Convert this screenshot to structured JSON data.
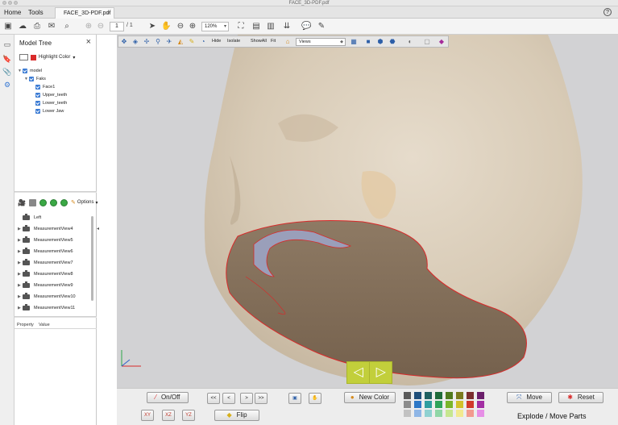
{
  "window": {
    "title": "FACE_3D-PDF.pdf"
  },
  "tabs": {
    "home": "Home",
    "tools": "Tools",
    "doc": "FACE_3D-PDF.pdf",
    "close": "×",
    "help": "?"
  },
  "toolbar": {
    "page_current": "1",
    "page_total": "/ 1",
    "zoom": "120%",
    "icons": [
      "save-icon",
      "upload-icon",
      "print-icon",
      "email-icon",
      "search-icon",
      "prev-page-icon",
      "next-page-icon",
      "select-cursor-icon",
      "hand-icon",
      "zoom-out-icon",
      "zoom-in-icon",
      "fit-page-icon",
      "fit-width-icon",
      "fit-height-icon",
      "scroll-mode-icon",
      "comment-icon",
      "sign-icon"
    ]
  },
  "left_rail": {
    "icons": [
      "pages-icon",
      "bookmark-icon",
      "attachment-icon",
      "model-tree-icon"
    ]
  },
  "model_tree": {
    "title": "Model Tree",
    "close": "×",
    "highlight_label": "Highlight Color",
    "highlight_color": "#d92b2b",
    "items": [
      {
        "label": "model",
        "level": 0,
        "expanded": true
      },
      {
        "label": "Faks",
        "level": 1,
        "expanded": true
      },
      {
        "label": "Face1",
        "level": 2
      },
      {
        "label": "Upper_teeth",
        "level": 2
      },
      {
        "label": "Lower_teeth",
        "level": 2
      },
      {
        "label": "Lower Jaw",
        "level": 2
      }
    ],
    "options_label": "Options",
    "views": [
      {
        "label": "Left",
        "arrow": false
      },
      {
        "label": "MeasurementView4",
        "arrow": true
      },
      {
        "label": "MeasurementView5",
        "arrow": true
      },
      {
        "label": "MeasurementView6",
        "arrow": true
      },
      {
        "label": "MeasurementView7",
        "arrow": true
      },
      {
        "label": "MeasurementView8",
        "arrow": true
      },
      {
        "label": "MeasurementView9",
        "arrow": true
      },
      {
        "label": "MeasurementView10",
        "arrow": true
      },
      {
        "label": "MeasurementView11",
        "arrow": true
      }
    ],
    "property_col": "Property",
    "value_col": "Value"
  },
  "toolbar_3d": {
    "hide": "Hide",
    "isolate": "Isolate",
    "show_all": "ShowAll",
    "fit": "Fit",
    "views_select": "Views"
  },
  "nav": {
    "prev": "◁",
    "next": "▷"
  },
  "controls": {
    "onoff": "On/Off",
    "first": "<<",
    "prev": "<",
    "next": ">",
    "last": ">>",
    "new_color": "New Color",
    "move": "Move",
    "reset": "Reset",
    "flip": "Flip",
    "axis_xy": "XY",
    "axis_xz": "XZ",
    "axis_yz": "YZ",
    "explode_label": "Explode / Move Parts",
    "palette": [
      "#5a5a5a",
      "#1f4e79",
      "#1f5f5f",
      "#1f6b3a",
      "#4f7a1e",
      "#7a7a1e",
      "#7a2e2e",
      "#6b1f6b",
      "#8c8c8c",
      "#2e78c7",
      "#2f9ea0",
      "#2fa35a",
      "#7ab52b",
      "#d1c12b",
      "#d1392b",
      "#a32fa3",
      "#c2c2c2",
      "#8fb6e6",
      "#8fd1d1",
      "#8fd6a6",
      "#c6e68f",
      "#f2e98f",
      "#f29a8f",
      "#e68fe6"
    ]
  }
}
